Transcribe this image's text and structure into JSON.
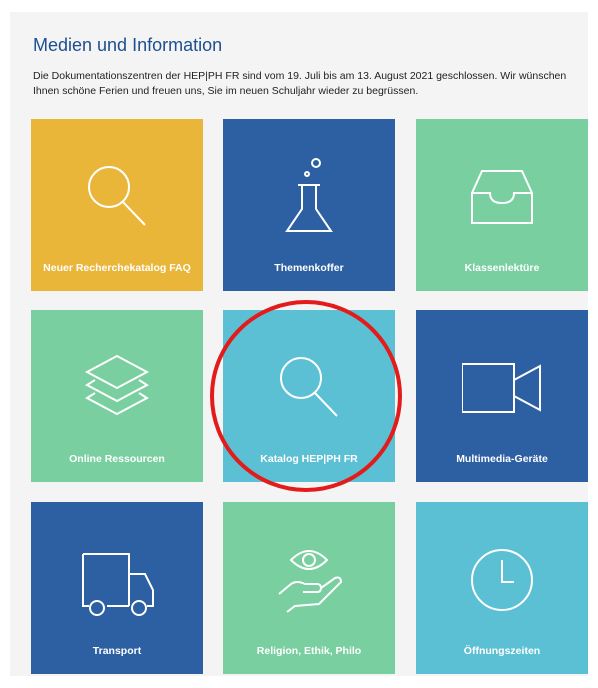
{
  "page": {
    "heading": "Medien und Information",
    "notice": "Die Dokumentationszentren der HEP|PH FR sind vom 19. Juli bis am 13. August 2021 geschlossen. Wir wünschen Ihnen schöne Ferien und freuen uns, Sie im neuen Schuljahr wieder zu begrüssen."
  },
  "tiles": [
    {
      "label": "Neuer Recherchekatalog FAQ",
      "icon": "search-icon",
      "color": "#e9b63a"
    },
    {
      "label": "Themenkoffer",
      "icon": "flask-icon",
      "color": "#2d5fa3"
    },
    {
      "label": "Klassenlektüre",
      "icon": "tray-icon",
      "color": "#79cfa0"
    },
    {
      "label": "Online Ressourcen",
      "icon": "layers-icon",
      "color": "#79cfa0"
    },
    {
      "label": "Katalog HEP|PH FR",
      "icon": "search-icon",
      "color": "#5bc0d3"
    },
    {
      "label": "Multimedia-Geräte",
      "icon": "video-camera-icon",
      "color": "#2d5fa3"
    },
    {
      "label": "Transport",
      "icon": "truck-icon",
      "color": "#2d5fa3"
    },
    {
      "label": "Religion, Ethik, Philo",
      "icon": "eye-hand-icon",
      "color": "#79cfa0"
    },
    {
      "label": "Öffnungszeiten",
      "icon": "clock-icon",
      "color": "#5bc0d3"
    }
  ],
  "highlight": {
    "target": "Katalog HEP|PH FR",
    "color": "#e31b1b"
  }
}
